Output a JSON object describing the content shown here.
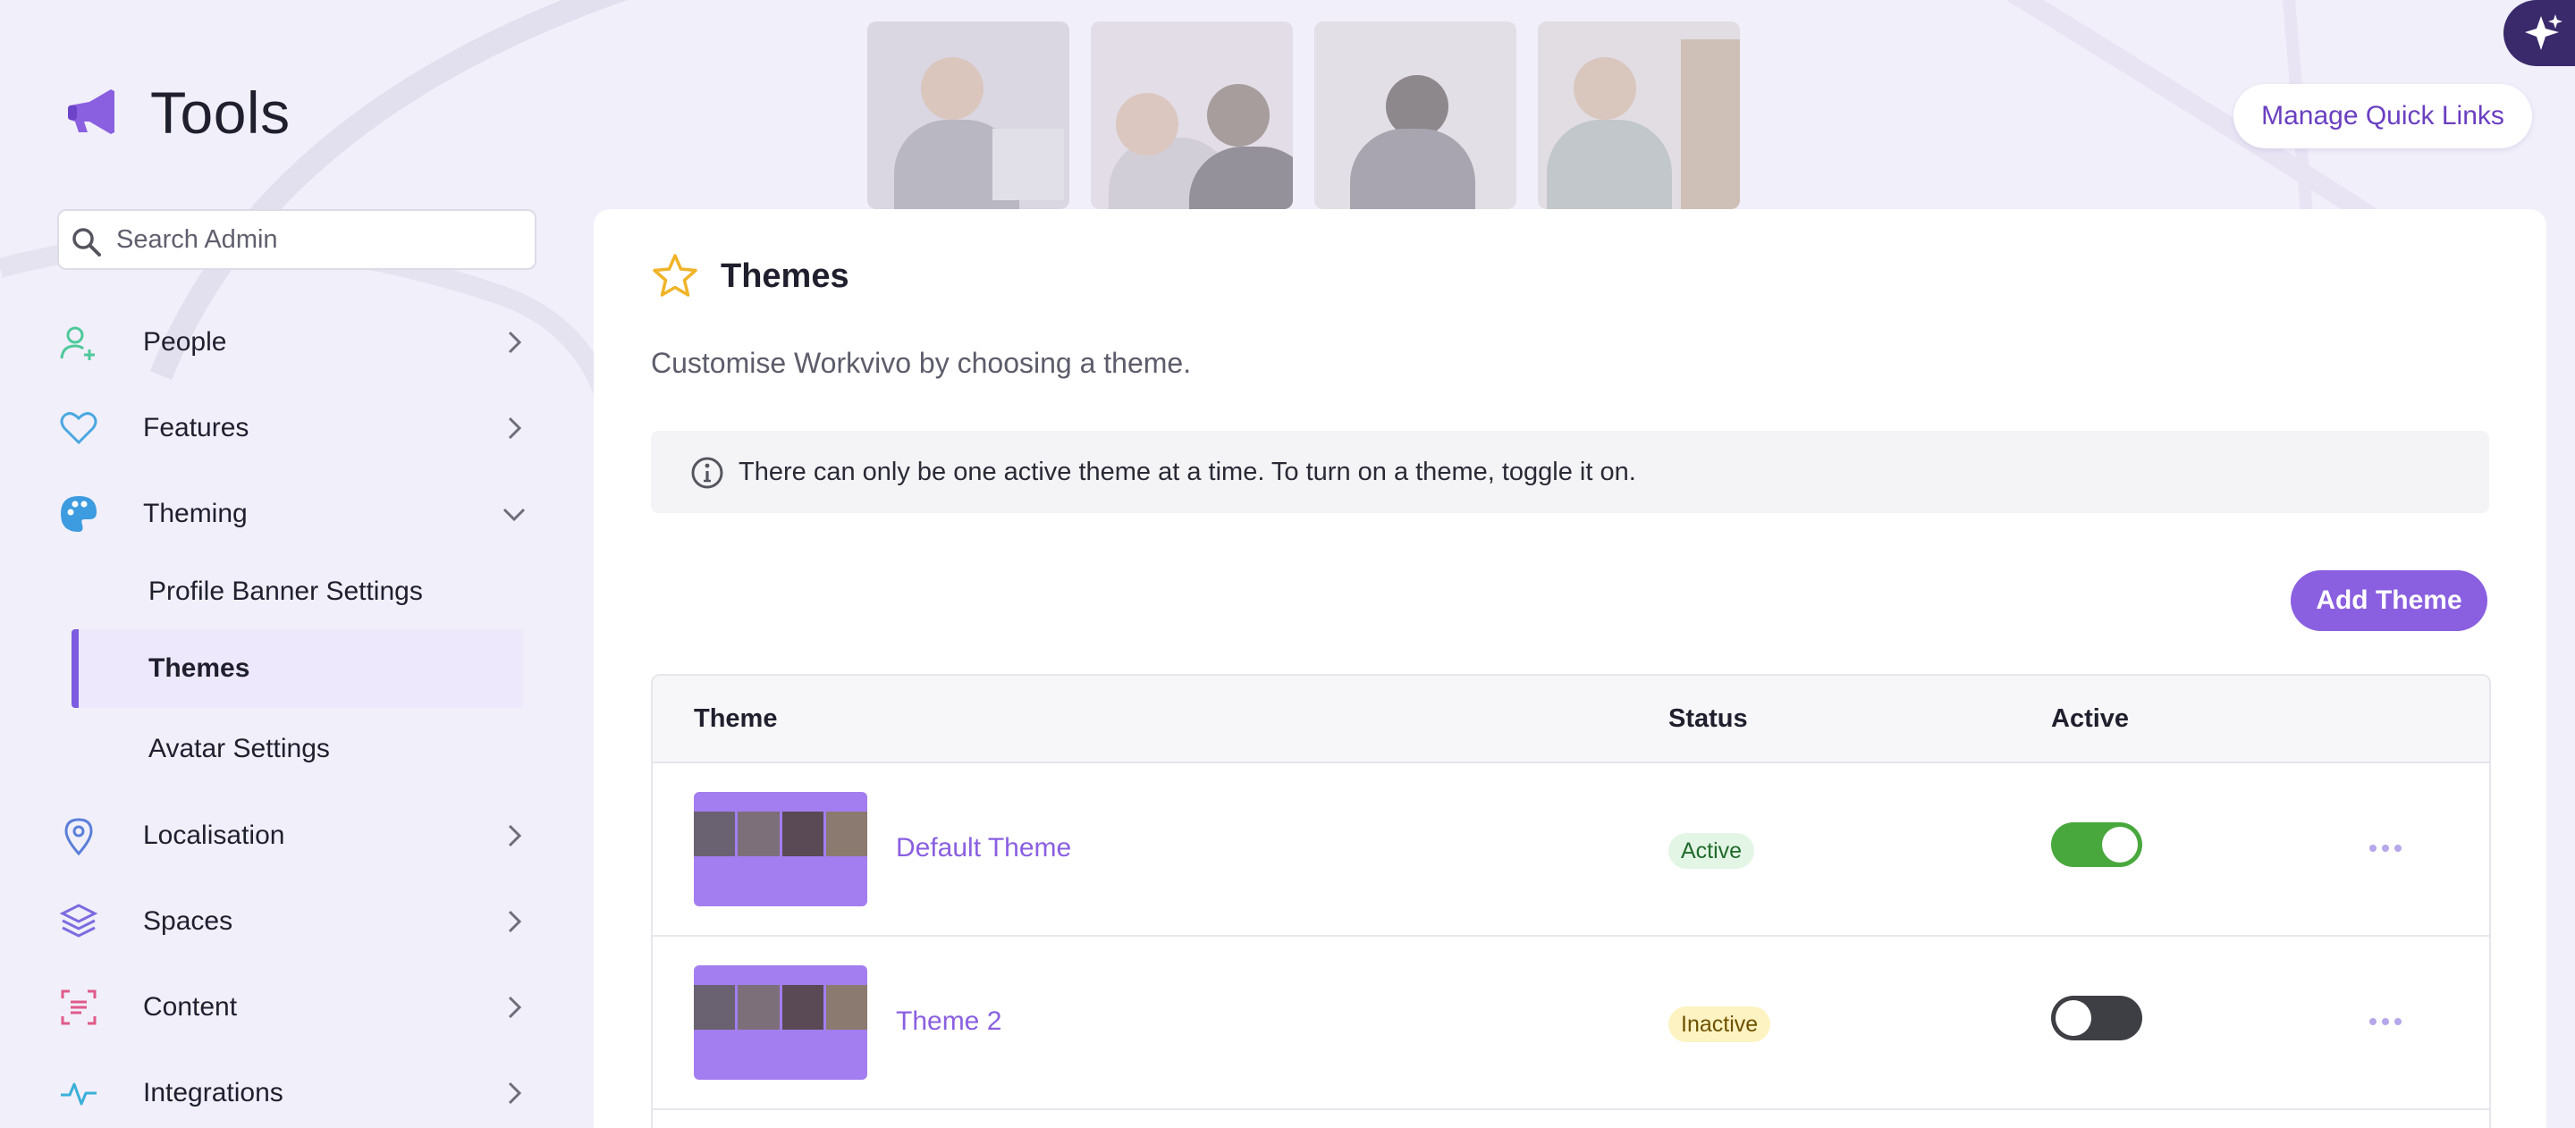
{
  "app": {
    "title": "Tools"
  },
  "header": {
    "quick_links_label": "Manage Quick Links"
  },
  "search": {
    "placeholder": "Search Admin",
    "value": ""
  },
  "sidebar": {
    "items": [
      {
        "label": "People",
        "icon": "person-add-icon",
        "color": "#4fc99a"
      },
      {
        "label": "Features",
        "icon": "heart-icon",
        "color": "#4aa8e0"
      },
      {
        "label": "Theming",
        "icon": "palette-icon",
        "color": "#3d9be0",
        "expanded": true,
        "children": [
          {
            "label": "Profile Banner Settings"
          },
          {
            "label": "Themes",
            "active": true
          },
          {
            "label": "Avatar Settings"
          }
        ]
      },
      {
        "label": "Localisation",
        "icon": "map-pin-icon",
        "color": "#5b7fd8"
      },
      {
        "label": "Spaces",
        "icon": "layers-icon",
        "color": "#7b6ce0"
      },
      {
        "label": "Content",
        "icon": "document-scan-icon",
        "color": "#e05a8a"
      },
      {
        "label": "Integrations",
        "icon": "activity-icon",
        "color": "#3ab0d8"
      }
    ]
  },
  "main": {
    "title": "Themes",
    "description": "Customise Workvivo by choosing a theme.",
    "info": "There can only be one active theme at a time. To turn on a theme, toggle it on.",
    "add_button": "Add Theme",
    "accent": "#8a5fe0",
    "table": {
      "columns": [
        "Theme",
        "Status",
        "Active"
      ],
      "rows": [
        {
          "name": "Default Theme",
          "status": "Active",
          "active": true
        },
        {
          "name": "Theme 2",
          "status": "Inactive",
          "active": false
        }
      ]
    }
  }
}
